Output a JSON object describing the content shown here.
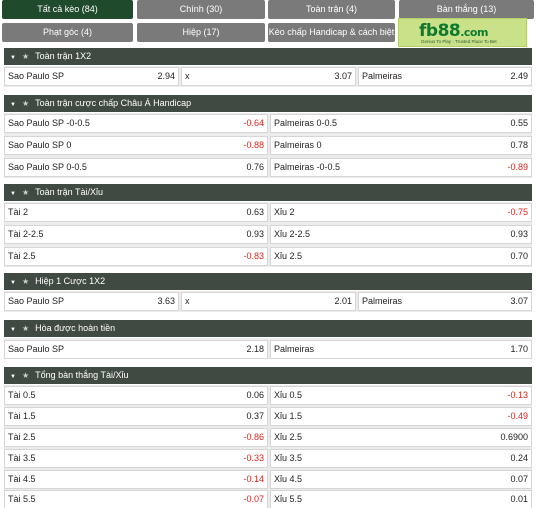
{
  "tabs": [
    {
      "label": "Tất cả kèo (84)",
      "active": true
    },
    {
      "label": "Chính (30)"
    },
    {
      "label": "Toàn trận (4)"
    },
    {
      "label": "Bàn thắng (13)"
    },
    {
      "label": "Phạt góc (4)"
    },
    {
      "label": "Hiệp (17)"
    },
    {
      "label": "Kèo chấp Handicap & cách biệt (3)"
    }
  ],
  "logo": {
    "text_main": "fb88",
    "text_tld": ".com",
    "tagline": "Genius To Play · Trusted Place To Bet"
  },
  "sections": {
    "s1": {
      "title": "Toàn trận 1X2",
      "row": {
        "home_label": "Sao Paulo SP",
        "home_val": "2.94",
        "draw_label": "x",
        "draw_val": "3.07",
        "away_label": "Palmeiras",
        "away_val": "2.49"
      }
    },
    "s2": {
      "title": "Toàn trận cược chấp Châu Á Handicap",
      "rows": [
        {
          "l": "Sao Paulo SP -0-0.5",
          "lv": "-0.64",
          "r": "Palmeiras 0-0.5",
          "rv": "0.55"
        },
        {
          "l": "Sao Paulo SP 0",
          "lv": "-0.88",
          "r": "Palmeiras 0",
          "rv": "0.78"
        },
        {
          "l": "Sao Paulo SP 0-0.5",
          "lv": "0.76",
          "r": "Palmeiras -0-0.5",
          "rv": "-0.89"
        }
      ]
    },
    "s3": {
      "title": "Toàn trận Tài/Xỉu",
      "rows": [
        {
          "l": "Tài 2",
          "lv": "0.63",
          "r": "Xỉu 2",
          "rv": "-0.75"
        },
        {
          "l": "Tài 2-2.5",
          "lv": "0.93",
          "r": "Xỉu 2-2.5",
          "rv": "0.93"
        },
        {
          "l": "Tài 2.5",
          "lv": "-0.83",
          "r": "Xỉu 2.5",
          "rv": "0.70"
        }
      ]
    },
    "s4": {
      "title": "Hiệp 1 Cược 1X2",
      "row": {
        "home_label": "Sao Paulo SP",
        "home_val": "3.63",
        "draw_label": "x",
        "draw_val": "2.01",
        "away_label": "Palmeiras",
        "away_val": "3.07"
      }
    },
    "s5": {
      "title": "Hòa được hoàn tiền",
      "row": {
        "l": "Sao Paulo SP",
        "lv": "2.18",
        "r": "Palmeiras",
        "rv": "1.70"
      }
    },
    "s6": {
      "title": "Tổng bàn thắng Tài/Xỉu",
      "rows": [
        {
          "l": "Tài 0.5",
          "lv": "0.06",
          "r": "Xỉu 0.5",
          "rv": "-0.13"
        },
        {
          "l": "Tài 1.5",
          "lv": "0.37",
          "r": "Xỉu 1.5",
          "rv": "-0.49"
        },
        {
          "l": "Tài 2.5",
          "lv": "-0.86",
          "r": "Xỉu 2.5",
          "rv": "0.6900"
        },
        {
          "l": "Tài 3.5",
          "lv": "-0.33",
          "r": "Xỉu 3.5",
          "rv": "0.24"
        },
        {
          "l": "Tài 4.5",
          "lv": "-0.14",
          "r": "Xỉu 4.5",
          "rv": "0.07"
        },
        {
          "l": "Tài 5.5",
          "lv": "-0.07",
          "r": "Xỉu 5.5",
          "rv": "0.01"
        }
      ]
    }
  },
  "colors": {
    "active_tab": "#1f4a2b",
    "tab": "#7a7a7a",
    "section_header": "#3f4a43",
    "negative": "#e0241c"
  }
}
